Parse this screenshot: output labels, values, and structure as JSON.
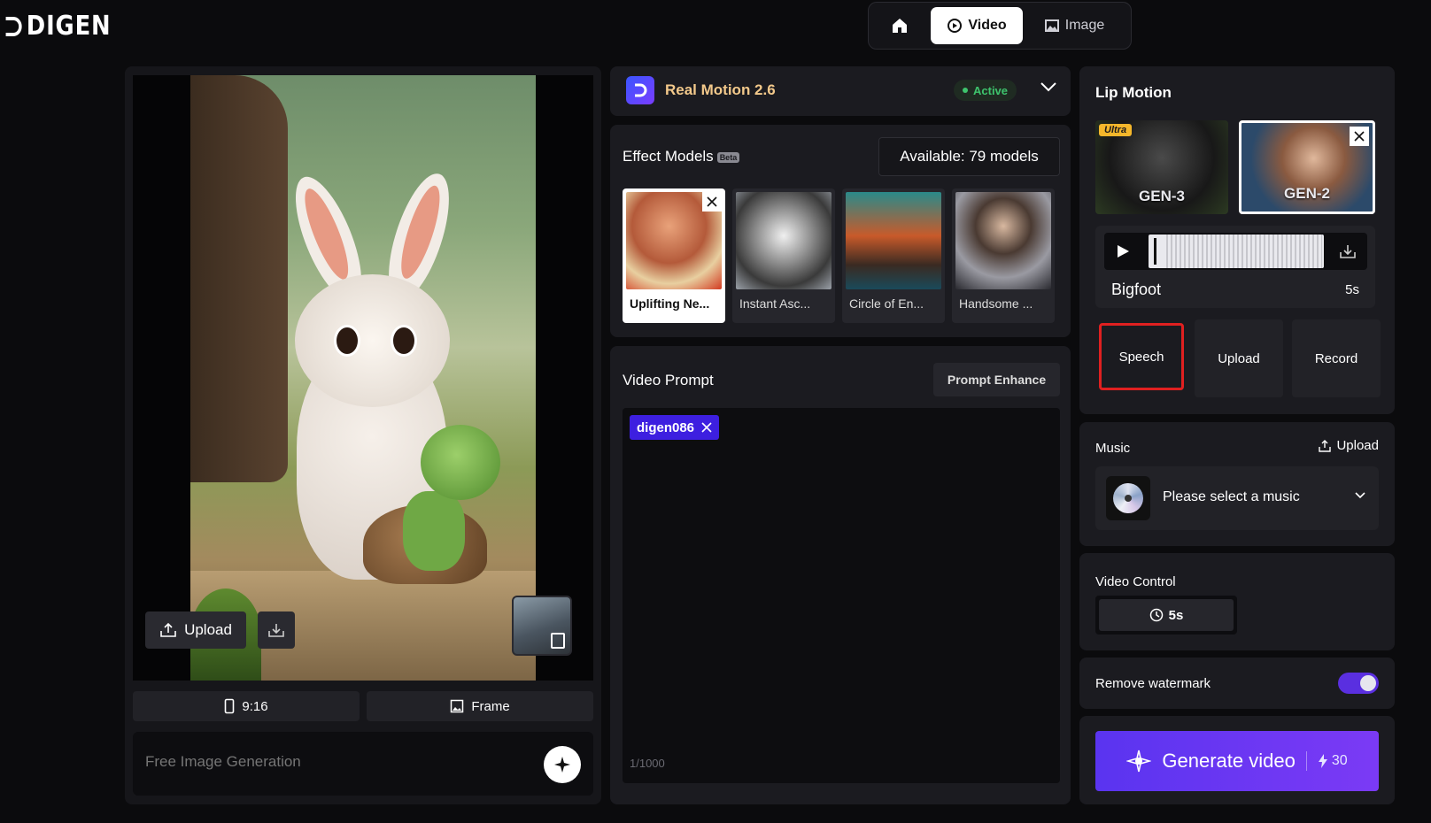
{
  "header": {
    "logo_text": "DIGEN",
    "nav": [
      {
        "label": "",
        "icon": "home-icon",
        "active": false
      },
      {
        "label": "Video",
        "icon": "video-icon",
        "active": true
      },
      {
        "label": "Image",
        "icon": "image-icon",
        "active": false
      }
    ]
  },
  "left": {
    "upload_label": "Upload",
    "aspect_ratio": "9:16",
    "frame_label": "Frame",
    "free_gen_placeholder": "Free Image Generation"
  },
  "model": {
    "name": "Real Motion 2.6",
    "status": "Active",
    "status_color": "#3ec46d",
    "name_color": "#f3c98b"
  },
  "effects": {
    "title": "Effect Models",
    "badge": "Beta",
    "available": "Available: 79 models",
    "items": [
      {
        "label": "Uplifting Ne...",
        "selected": true
      },
      {
        "label": "Instant Asc...",
        "selected": false
      },
      {
        "label": "Circle of En...",
        "selected": false
      },
      {
        "label": "Handsome ...",
        "selected": false
      }
    ]
  },
  "prompt": {
    "title": "Video Prompt",
    "enhance_label": "Prompt Enhance",
    "tag": "digen086",
    "char_count": "1/1000"
  },
  "lip_motion": {
    "title": "Lip Motion",
    "models": [
      {
        "label": "GEN-3",
        "badge": "Ultra",
        "selected": false
      },
      {
        "label": "GEN-2",
        "badge": "",
        "selected": true
      }
    ],
    "voice_name": "Bigfoot",
    "voice_duration": "5s",
    "sources": [
      "Speech",
      "Upload",
      "Record"
    ],
    "highlight_color": "#e02020"
  },
  "music": {
    "title": "Music",
    "upload_label": "Upload",
    "placeholder": "Please select a music"
  },
  "video_control": {
    "title": "Video Control",
    "duration": "5s"
  },
  "watermark": {
    "label": "Remove watermark",
    "enabled": true
  },
  "generate": {
    "label": "Generate video",
    "cost": "30",
    "accent": "#5a34f0"
  }
}
